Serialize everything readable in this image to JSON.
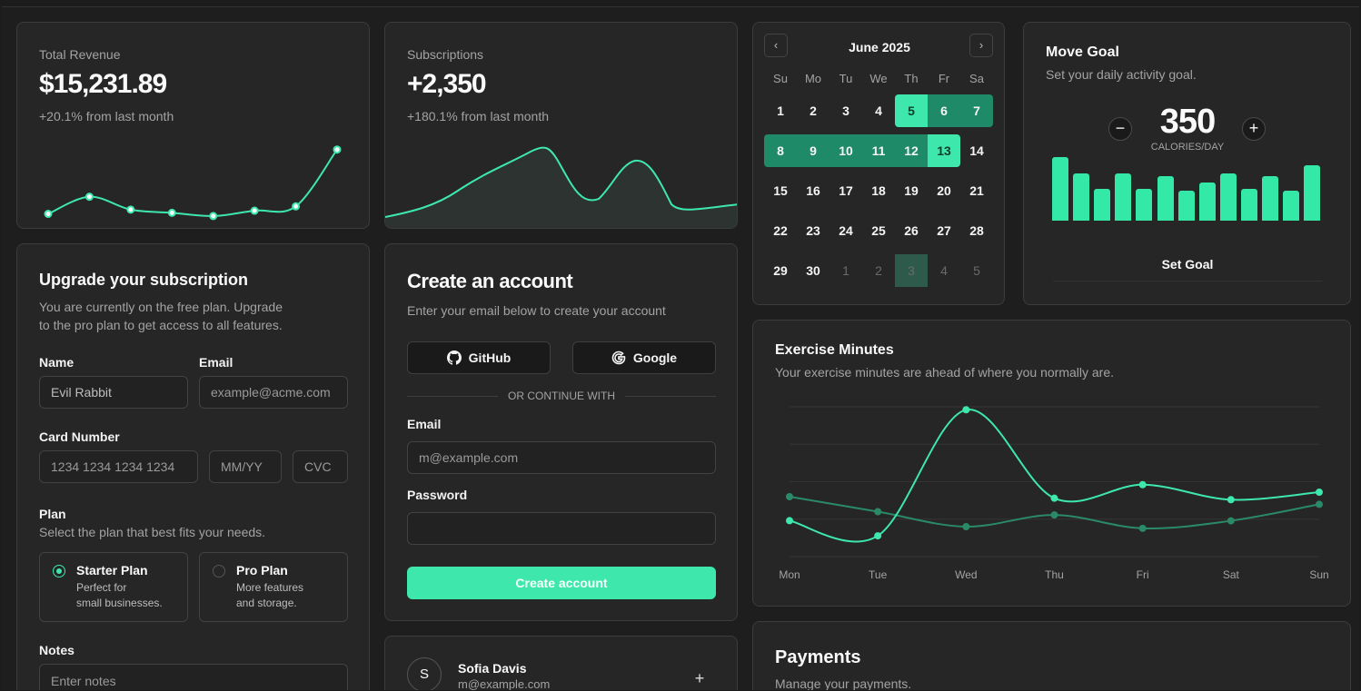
{
  "revenue": {
    "label": "Total Revenue",
    "value": "$15,231.89",
    "change": "+20.1% from last month",
    "series": [
      10400,
      11200,
      10600,
      10450,
      10300,
      10550,
      10750,
      13400
    ]
  },
  "subscriptions": {
    "label": "Subscriptions",
    "value": "+2,350",
    "change": "+180.1% from last month"
  },
  "calendar": {
    "month": "June 2025",
    "weekdays": [
      "Su",
      "Mo",
      "Tu",
      "We",
      "Th",
      "Fr",
      "Sa"
    ],
    "rows": [
      [
        "1",
        "2",
        "3",
        "4",
        "5",
        "6",
        "7"
      ],
      [
        "8",
        "9",
        "10",
        "11",
        "12",
        "13",
        "14"
      ],
      [
        "15",
        "16",
        "17",
        "18",
        "19",
        "20",
        "21"
      ],
      [
        "22",
        "23",
        "24",
        "25",
        "26",
        "27",
        "28"
      ],
      [
        "29",
        "30",
        "1",
        "2",
        "3",
        "4",
        "5"
      ]
    ],
    "range_start": "5",
    "range_end": "13",
    "today_next_month": "3"
  },
  "move_goal": {
    "title": "Move Goal",
    "subtitle": "Set your daily activity goal.",
    "value": "350",
    "unit": "CALORIES/DAY",
    "button": "Set Goal",
    "bars": [
      400,
      300,
      200,
      300,
      200,
      278,
      189,
      239,
      300,
      200,
      278,
      189,
      349
    ]
  },
  "upgrade": {
    "title": "Upgrade your subscription",
    "subtitle_line1": "You are currently on the free plan. Upgrade",
    "subtitle_line2": "to the pro plan to get access to all features.",
    "name_label": "Name",
    "name_value": "Evil Rabbit",
    "email_label": "Email",
    "email_placeholder": "example@acme.com",
    "card_label": "Card Number",
    "card_placeholder": "1234 1234 1234 1234",
    "exp_placeholder": "MM/YY",
    "cvc_placeholder": "CVC",
    "plan_label": "Plan",
    "plan_hint": "Select the plan that best fits your needs.",
    "plans": [
      {
        "name": "Starter Plan",
        "desc1": "Perfect for",
        "desc2": "small businesses.",
        "selected": true
      },
      {
        "name": "Pro Plan",
        "desc1": "More features",
        "desc2": "and storage.",
        "selected": false
      }
    ],
    "notes_label": "Notes",
    "notes_placeholder": "Enter notes"
  },
  "account": {
    "title": "Create an account",
    "subtitle": "Enter your email below to create your account",
    "github": "GitHub",
    "google": "Google",
    "divider": "OR CONTINUE WITH",
    "email_label": "Email",
    "email_placeholder": "m@example.com",
    "password_label": "Password",
    "submit": "Create account"
  },
  "member": {
    "initial": "S",
    "name": "Sofia Davis",
    "email": "m@example.com"
  },
  "exercise": {
    "title": "Exercise Minutes",
    "subtitle": "Your exercise minutes are ahead of where you normally are."
  },
  "payments": {
    "title": "Payments",
    "subtitle": "Manage your payments."
  },
  "chart_data": {
    "type": "line",
    "categories": [
      "Mon",
      "Tue",
      "Wed",
      "Thu",
      "Fri",
      "Sat",
      "Sun"
    ],
    "series": [
      {
        "values": [
          240,
          139,
          980,
          390,
          480,
          380,
          430
        ],
        "color": "#3ee8ad"
      },
      {
        "values": [
          400,
          300,
          200,
          278,
          189,
          239,
          349
        ],
        "color": "#2a8a68"
      }
    ],
    "ylim": [
      0,
      1000
    ],
    "grid": true
  },
  "colors": {
    "accent": "#3ee8ad",
    "accent_dark": "#1e8a68",
    "card": "#262626",
    "border": "#3c3c3c"
  }
}
